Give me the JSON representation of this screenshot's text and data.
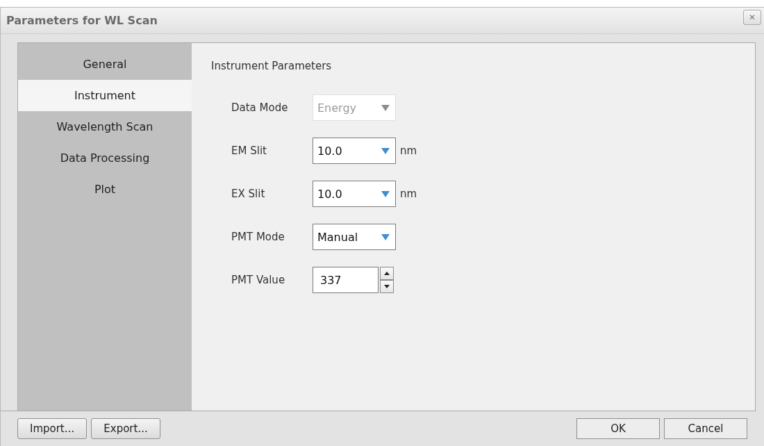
{
  "window": {
    "title": "Parameters for WL Scan",
    "close": "✕"
  },
  "sidebar": {
    "items": [
      {
        "label": "General",
        "selected": false
      },
      {
        "label": "Instrument",
        "selected": true
      },
      {
        "label": "Wavelength Scan",
        "selected": false
      },
      {
        "label": "Data Processing",
        "selected": false
      },
      {
        "label": "Plot",
        "selected": false
      }
    ]
  },
  "panel": {
    "heading": "Instrument Parameters",
    "fields": [
      {
        "kind": "dropdown",
        "label": "Data Mode",
        "value": "Energy",
        "disabled": true
      },
      {
        "kind": "dropdown",
        "label": "EM Slit",
        "value": "10.0",
        "unit": "nm",
        "disabled": false
      },
      {
        "kind": "dropdown",
        "label": "EX Slit",
        "value": "10.0",
        "unit": "nm",
        "disabled": false
      },
      {
        "kind": "dropdown",
        "label": "PMT Mode",
        "value": "Manual",
        "disabled": false
      },
      {
        "kind": "spinner",
        "label": "PMT Value",
        "value": "337",
        "disabled": false
      }
    ]
  },
  "footer": {
    "left_buttons": [
      "Import...",
      "Export..."
    ],
    "right_buttons": [
      "OK",
      "Cancel"
    ]
  }
}
